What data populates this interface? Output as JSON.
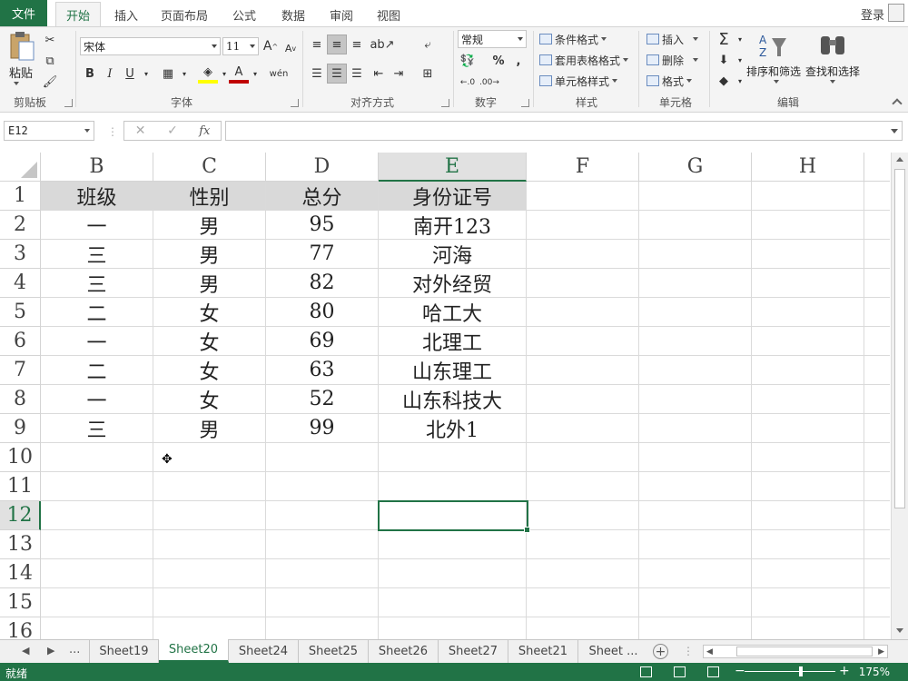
{
  "ribbon": {
    "file_tab": "文件",
    "tabs": [
      "开始",
      "插入",
      "页面布局",
      "公式",
      "数据",
      "审阅",
      "视图"
    ],
    "active_tab": "开始",
    "login": "登录",
    "groups": {
      "clipboard": "剪贴板",
      "font": "字体",
      "alignment": "对齐方式",
      "number": "数字",
      "styles": "样式",
      "cells": "单元格",
      "editing": "编辑"
    },
    "paste_label": "粘贴",
    "font_name": "宋体",
    "font_size": "11",
    "number_format": "常规",
    "conditional_format": "条件格式",
    "table_format": "套用表格格式",
    "cell_styles": "单元格样式",
    "insert": "插入",
    "delete": "删除",
    "format": "格式",
    "sort_filter": "排序和筛选",
    "find_select": "查找和选择"
  },
  "formula_bar": {
    "name_box": "E12",
    "fx": "fx",
    "formula": ""
  },
  "grid": {
    "columns": [
      "B",
      "C",
      "D",
      "E",
      "F",
      "G",
      "H"
    ],
    "selected_column": "E",
    "rows": [
      "1",
      "2",
      "3",
      "4",
      "5",
      "6",
      "7",
      "8",
      "9",
      "10",
      "11",
      "12",
      "13",
      "14",
      "15",
      "16"
    ],
    "selected_row": "12",
    "header_row": [
      "班级",
      "性别",
      "总分",
      "身份证号"
    ],
    "data": [
      [
        "一",
        "男",
        "95",
        "南开123"
      ],
      [
        "三",
        "男",
        "77",
        "河海"
      ],
      [
        "三",
        "男",
        "82",
        "对外经贸"
      ],
      [
        "二",
        "女",
        "80",
        "哈工大"
      ],
      [
        "一",
        "女",
        "69",
        "北理工"
      ],
      [
        "二",
        "女",
        "63",
        "山东理工"
      ],
      [
        "一",
        "女",
        "52",
        "山东科技大"
      ],
      [
        "三",
        "男",
        "99",
        "北外1"
      ]
    ]
  },
  "sheets": {
    "ellipsis": "...",
    "tabs": [
      "Sheet19",
      "Sheet20",
      "Sheet24",
      "Sheet25",
      "Sheet26",
      "Sheet27",
      "Sheet21",
      "Sheet ..."
    ],
    "active": "Sheet20"
  },
  "status": {
    "ready": "就绪",
    "zoom": "175%"
  },
  "colors": {
    "accent": "#217346",
    "header_fill": "#d9d9d9"
  }
}
